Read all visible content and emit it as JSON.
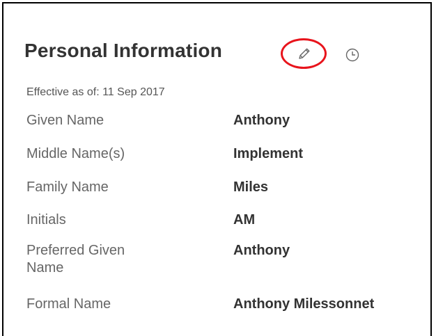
{
  "section": {
    "title": "Personal Information",
    "effective_label": "Effective as of: 11 Sep 2017"
  },
  "icons": {
    "edit": "pencil-icon",
    "history": "clock-icon",
    "highlight_color": "#e8141c"
  },
  "fields": [
    {
      "label": "Given Name",
      "value": "Anthony"
    },
    {
      "label": "Middle Name(s)",
      "value": "Implement"
    },
    {
      "label": "Family Name",
      "value": "Miles"
    },
    {
      "label": "Initials",
      "value": "AM"
    },
    {
      "label": "Preferred Given Name",
      "value": "Anthony"
    },
    {
      "label": "Formal Name",
      "value": "Anthony Milessonnet"
    }
  ]
}
